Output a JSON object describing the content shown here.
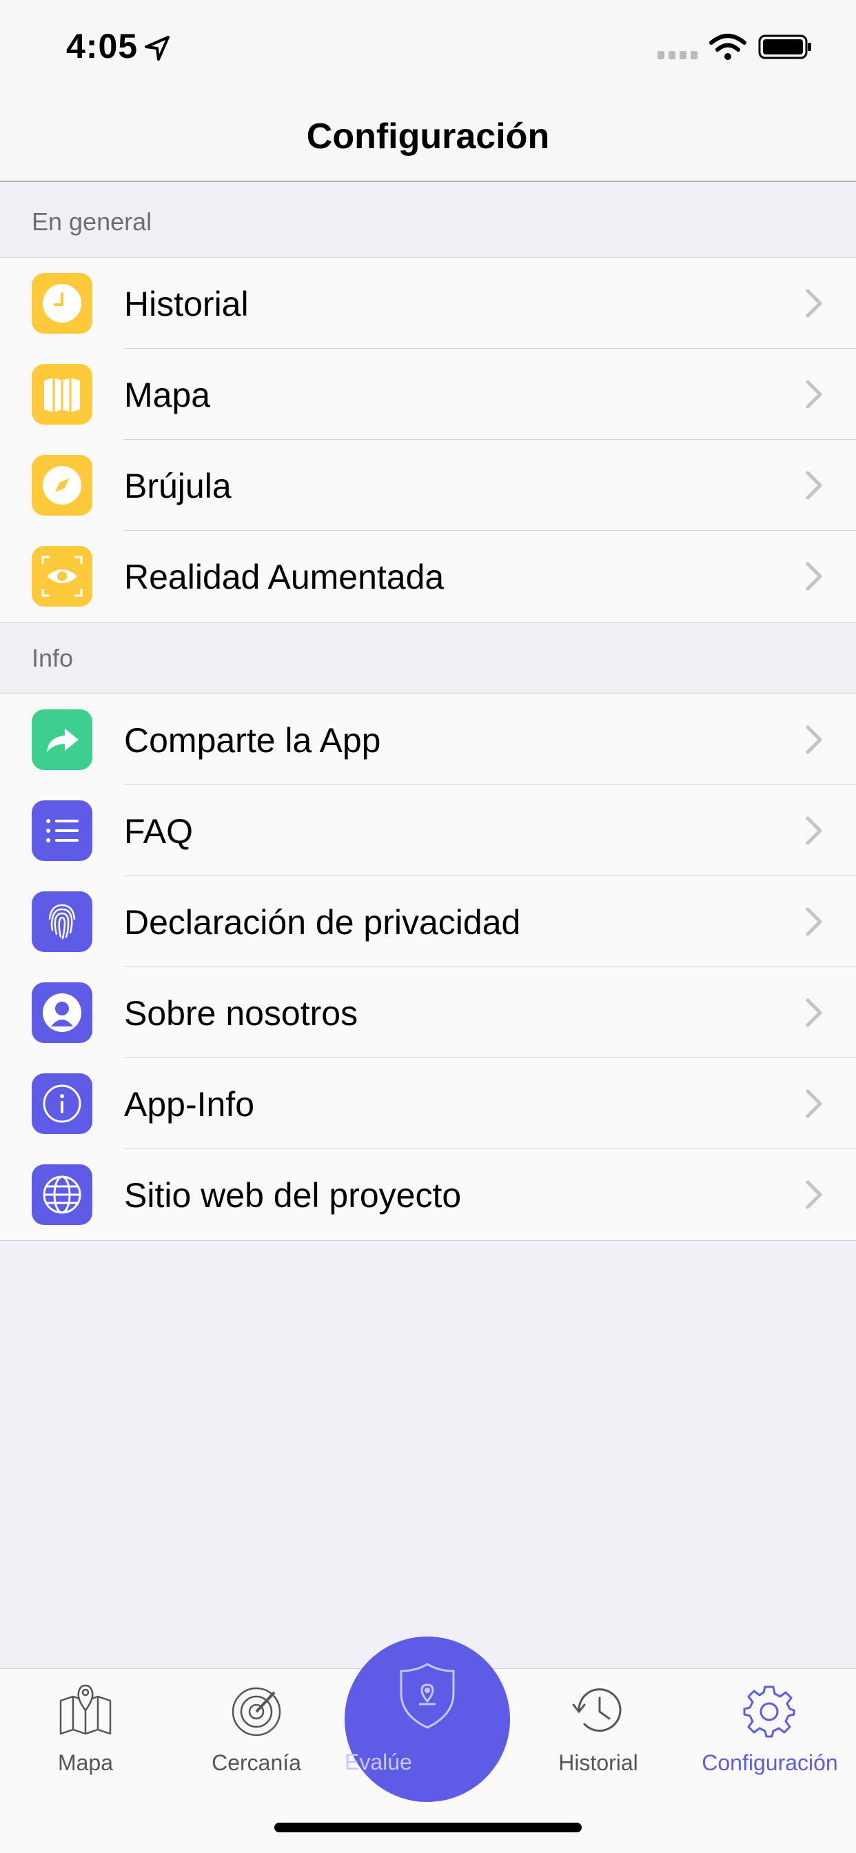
{
  "status_bar": {
    "time": "4:05"
  },
  "nav": {
    "title": "Configuración"
  },
  "sections": [
    {
      "header": "En general",
      "items": [
        {
          "label": "Historial",
          "icon": "clock-icon",
          "color": "#ffc93c"
        },
        {
          "label": "Mapa",
          "icon": "map-icon",
          "color": "#ffc93c"
        },
        {
          "label": "Brújula",
          "icon": "compass-icon",
          "color": "#ffc93c"
        },
        {
          "label": "Realidad Aumentada",
          "icon": "eye-icon",
          "color": "#ffc93c"
        }
      ]
    },
    {
      "header": "Info",
      "items": [
        {
          "label": "Comparte la App",
          "icon": "share-icon",
          "color": "#3ccf8e"
        },
        {
          "label": "FAQ",
          "icon": "list-icon",
          "color": "#5e5ce6"
        },
        {
          "label": "Declaración de privacidad",
          "icon": "fingerprint-icon",
          "color": "#5e5ce6"
        },
        {
          "label": "Sobre nosotros",
          "icon": "person-icon",
          "color": "#5e5ce6"
        },
        {
          "label": "App-Info",
          "icon": "info-icon",
          "color": "#5e5ce6"
        },
        {
          "label": "Sitio web del proyecto",
          "icon": "globe-icon",
          "color": "#5e5ce6"
        }
      ]
    }
  ],
  "tab_bar": {
    "items": [
      {
        "label": "Mapa",
        "icon": "map-pin-icon"
      },
      {
        "label": "Cercanía",
        "icon": "radar-icon"
      },
      {
        "label": "Evalúe",
        "icon": "shield-icon"
      },
      {
        "label": "Historial",
        "icon": "history-icon"
      },
      {
        "label": "Configuración",
        "icon": "gear-icon",
        "active": true
      }
    ]
  },
  "colors": {
    "accent": "#5e5ce6",
    "yellow": "#ffc93c",
    "green": "#3ccf8e"
  }
}
